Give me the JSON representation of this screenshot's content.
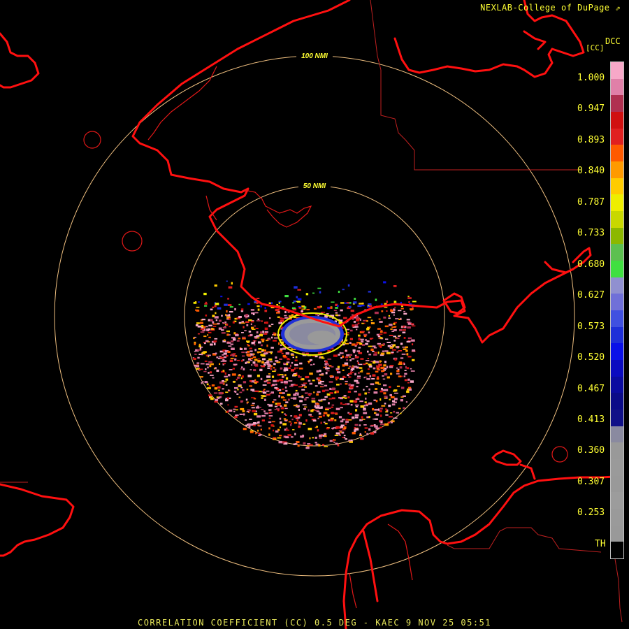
{
  "header": {
    "credit": "NEXLAB-College of DuPage",
    "product_code": "DCC",
    "unit": "[CC]"
  },
  "range_rings": [
    {
      "label": "100 NMI"
    },
    {
      "label": "50 NMI"
    }
  ],
  "colorbar": {
    "labels": [
      "1.000",
      "0.947",
      "0.893",
      "0.840",
      "0.787",
      "0.733",
      "0.680",
      "0.627",
      "0.573",
      "0.520",
      "0.467",
      "0.413",
      "0.360",
      "0.307",
      "0.253",
      "TH"
    ],
    "colors": [
      "#f7a8c8",
      "#e080a8",
      "#b03050",
      "#d01010",
      "#e02020",
      "#ff5a00",
      "#ff9a00",
      "#ffcc00",
      "#eeee00",
      "#c8d800",
      "#8cb800",
      "#5cc050",
      "#40e040",
      "#9090d0",
      "#7070d8",
      "#4050e0",
      "#1f2fd8",
      "#0a10e8",
      "#0a0ac0",
      "#0a0aa0",
      "#0a0a88",
      "#101088",
      "#8a8aa0",
      "#999999",
      "#9a9a9a",
      "#999999",
      "#9c9c9c",
      "#9a9a9a",
      "#999999",
      "#000000"
    ],
    "selected_marker": "#ffffff"
  },
  "colors": {
    "coastline": "#ff1010",
    "county_line": "#c02020",
    "range_ring": "#f0c080",
    "text": "#ffff33"
  },
  "footer": {
    "caption": "CORRELATION COEFFICIENT (CC) 0.5 DEG - KAEC 9 NOV 25 05:51"
  }
}
